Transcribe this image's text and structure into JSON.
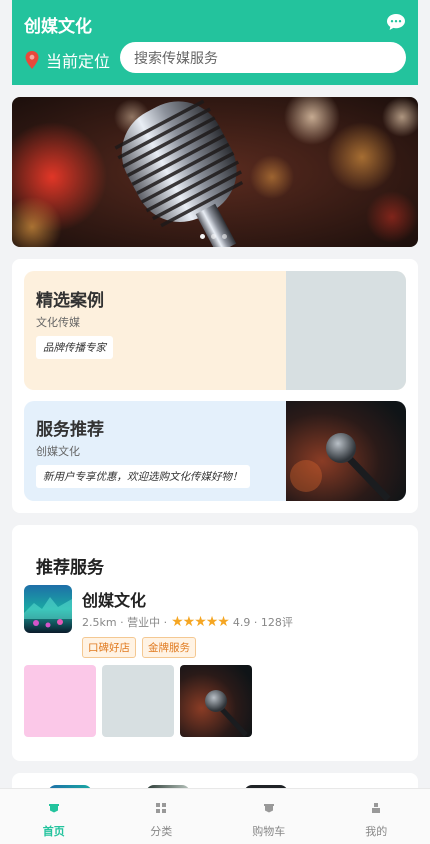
{
  "header": {
    "title": "创媒文化",
    "location_label": "当前定位",
    "search_placeholder": "搜索传媒服务",
    "chat_icon": "chat-bubble-icon",
    "pin_icon": "location-pin-icon"
  },
  "banner": {
    "dot_count": 3,
    "active_dot": 1
  },
  "cards": [
    {
      "title": "精选案例",
      "subtitle": "文化传媒",
      "tag": "品牌传播专家"
    },
    {
      "title": "服务推荐",
      "subtitle": "创媒文化",
      "tag": "新用户专享优惠，欢迎选购文化传媒好物！"
    }
  ],
  "recommend": {
    "title": "推荐服务",
    "shop": {
      "name": "创媒文化",
      "distance": "2.5km",
      "status": "营业中",
      "rating": "4.9",
      "rating_value": 4.9,
      "reviews": "128评",
      "tags": [
        "口碑好店",
        "金牌服务"
      ]
    }
  },
  "tabbar": {
    "tabs": [
      {
        "label": "首页",
        "icon": "home-icon",
        "active": true
      },
      {
        "label": "分类",
        "icon": "grid-icon",
        "active": false
      },
      {
        "label": "购物车",
        "icon": "cart-icon",
        "active": false
      },
      {
        "label": "我的",
        "icon": "user-icon",
        "active": false
      }
    ]
  },
  "colors": {
    "accent": "#23c39d",
    "star": "#f5a623",
    "tag_text": "#e07a1f"
  }
}
